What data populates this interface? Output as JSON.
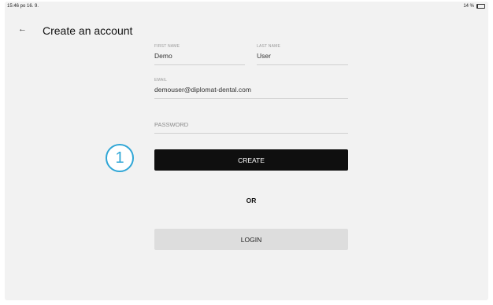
{
  "status_bar": {
    "time_date": "15:46  po 16. 9.",
    "battery_text": "14 %",
    "battery_level": 0.14
  },
  "header": {
    "back_icon": "arrow-left-icon",
    "title": "Create an account"
  },
  "form": {
    "first_name": {
      "label": "FIRST NAME",
      "value": "Demo"
    },
    "last_name": {
      "label": "LAST NAME",
      "value": "User"
    },
    "email": {
      "label": "EMAIL",
      "value": "demouser@diplomat-dental.com"
    },
    "password": {
      "placeholder": "PASSWORD"
    }
  },
  "actions": {
    "create_label": "CREATE",
    "or_label": "OR",
    "login_label": "LOGIN"
  },
  "annotation": {
    "step_number": "1",
    "color": "#2fa6d6"
  },
  "colors": {
    "create_bg": "#0f0f0f",
    "login_bg": "#dddddd",
    "screen_bg": "#f2f2f2"
  }
}
